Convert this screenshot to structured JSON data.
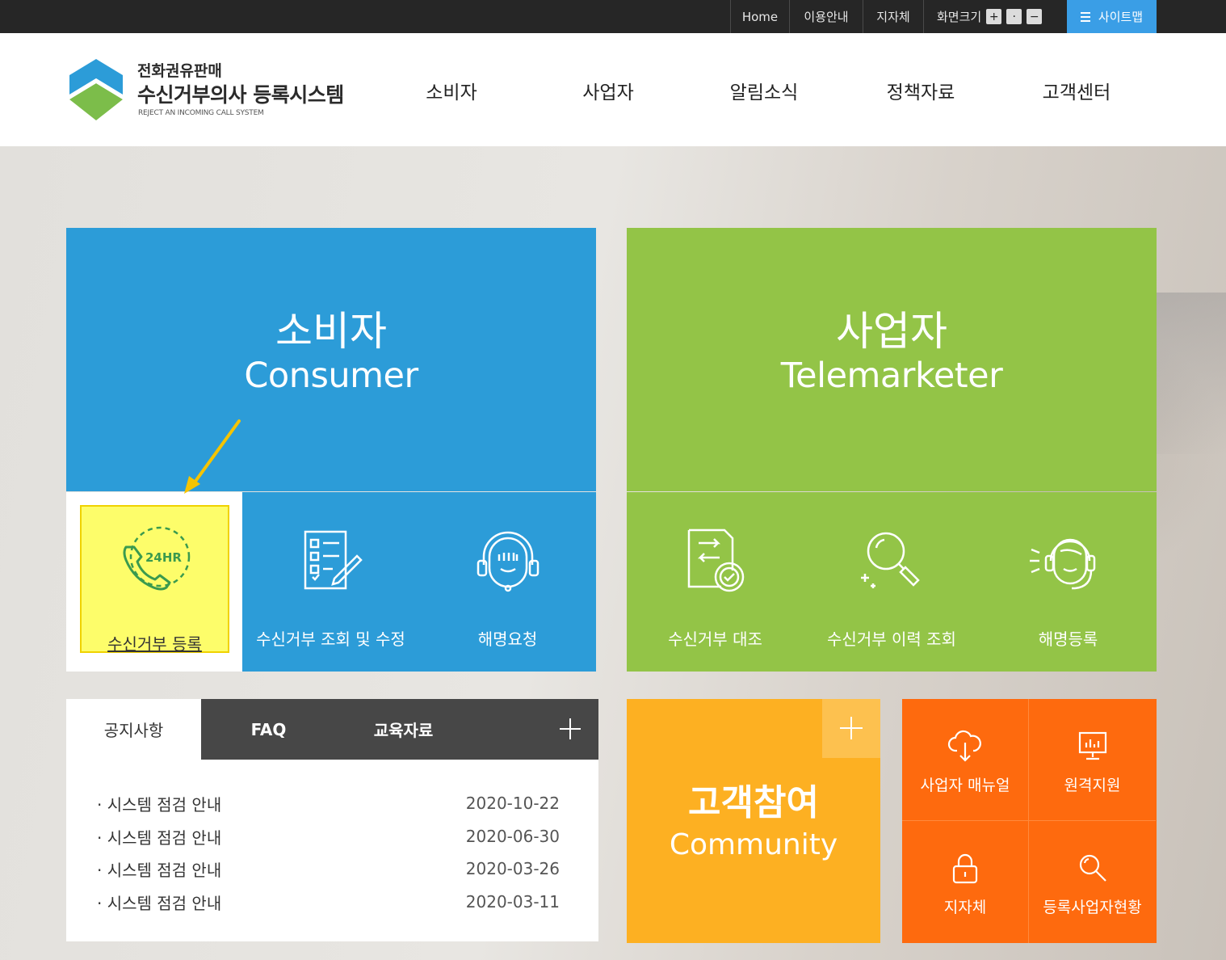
{
  "utility_bar": {
    "home": "Home",
    "guide": "이용안내",
    "local_gov": "지자체",
    "screen_size": "화면크기",
    "zoom_in": "+",
    "zoom_reset": "·",
    "zoom_out": "−",
    "sitemap": "사이트맵"
  },
  "logo": {
    "line1": "전화권유판매",
    "line2": "수신거부의사 등록시스템",
    "line3": "REJECT AN INCOMING CALL SYSTEM"
  },
  "gnb": [
    "소비자",
    "사업자",
    "알림소식",
    "정책자료",
    "고객센터"
  ],
  "consumer": {
    "title_ko": "소비자",
    "title_en": "Consumer",
    "tiles": [
      {
        "label": "수신거부 등록",
        "icon": "24hr-phone-icon",
        "badge": "24HR"
      },
      {
        "label": "수신거부 조회 및 수정",
        "icon": "checklist-icon"
      },
      {
        "label": "해명요청",
        "icon": "headset-agent-icon"
      }
    ]
  },
  "telemarketer": {
    "title_ko": "사업자",
    "title_en": "Telemarketer",
    "tiles": [
      {
        "label": "수신거부 대조",
        "icon": "document-compare-icon"
      },
      {
        "label": "수신거부 이력 조회",
        "icon": "magnifier-icon"
      },
      {
        "label": "해명등록",
        "icon": "call-agent-icon"
      }
    ]
  },
  "board": {
    "tabs": [
      "공지사항",
      "FAQ",
      "교육자료"
    ],
    "notices": [
      {
        "title": "· 시스템 점검 안내",
        "date": "2020-10-22"
      },
      {
        "title": "· 시스템 점검 안내",
        "date": "2020-06-30"
      },
      {
        "title": "· 시스템 점검 안내",
        "date": "2020-03-26"
      },
      {
        "title": "· 시스템 점검 안내",
        "date": "2020-03-11"
      }
    ]
  },
  "community": {
    "title_ko": "고객참여",
    "title_en": "Community"
  },
  "quick_links": [
    {
      "label": "사업자 매뉴얼",
      "icon": "cloud-download-icon"
    },
    {
      "label": "원격지원",
      "icon": "monitor-icon"
    },
    {
      "label": "지자체",
      "icon": "lock-icon"
    },
    {
      "label": "등록사업자현황",
      "icon": "search-icon"
    }
  ],
  "colors": {
    "consumer": "#2c9cd8",
    "telemarketer": "#93c447",
    "community": "#fdb022",
    "quick": "#fe6a0e",
    "highlight": "#fdfd6a",
    "arrow": "#f5c400"
  }
}
